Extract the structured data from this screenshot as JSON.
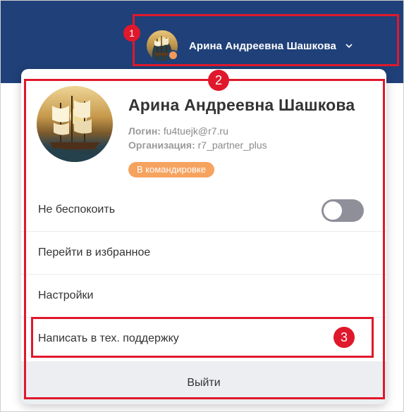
{
  "header": {
    "user_name": "Арина Андреевна Шашкова",
    "avatar_icon": "sailing-ship-avatar",
    "dropdown_icon": "chevron-down-icon",
    "background_color": "#1f4079"
  },
  "profile": {
    "full_name": "Арина Андреевна Шашкова",
    "login_label": "Логин:",
    "login_value": "fu4tuejk@r7.ru",
    "org_label": "Организация:",
    "org_value": "r7_partner_plus",
    "status_badge": "В командировке",
    "status_color": "#f6a35f"
  },
  "menu": {
    "do_not_disturb": "Не беспокоить",
    "do_not_disturb_enabled": false,
    "favorites": "Перейти в избранное",
    "settings": "Настройки",
    "support": "Написать в тех. поддержку",
    "logout": "Выйти"
  },
  "callouts": {
    "one": "1",
    "two": "2",
    "three": "3",
    "color": "#e0182b"
  }
}
